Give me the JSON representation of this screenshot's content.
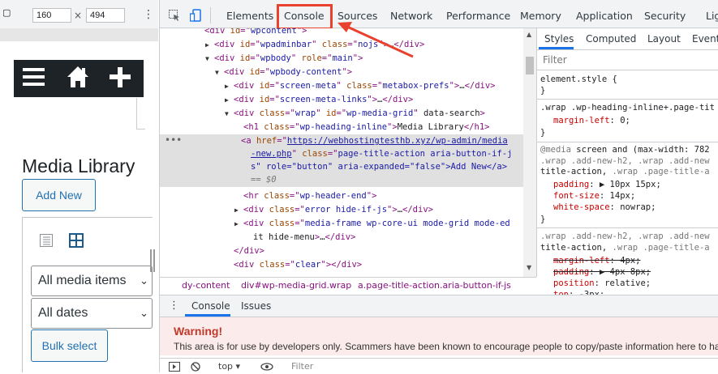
{
  "device_toolbar": {
    "selector_glyph": "▢",
    "width_value": "160",
    "height_value": "494",
    "times": "×",
    "more": "⋮"
  },
  "wordpress": {
    "page_title": "Media Library",
    "add_new": "Add New",
    "media_filter": "All media items",
    "date_filter": "All dates",
    "bulk_select": "Bulk select"
  },
  "devtools": {
    "tabs": [
      "Elements",
      "Console",
      "Sources",
      "Network",
      "Performance",
      "Memory",
      "Application",
      "Security",
      "Lig"
    ],
    "highlighted_tab": "Console",
    "elements_lines": [
      {
        "indent": 3,
        "tri": "",
        "html": "<div id=\"wpcontent\">"
      },
      {
        "indent": 4,
        "tri": "▶",
        "html": "<div id=\"wpadminbar\" class=\"nojs\">…</div>"
      },
      {
        "indent": 4,
        "tri": "▼",
        "html": "<div id=\"wpbody\" role=\"main\">"
      },
      {
        "indent": 5,
        "tri": "▼",
        "html": "<div id=\"wpbody-content\">"
      },
      {
        "indent": 6,
        "tri": "▶",
        "html": "<div id=\"screen-meta\" class=\"metabox-prefs\">…</div>"
      },
      {
        "indent": 6,
        "tri": "▶",
        "html": "<div id=\"screen-meta-links\">…</div>"
      },
      {
        "indent": 6,
        "tri": "▼",
        "html": "<div class=\"wrap\" id=\"wp-media-grid\" data-search>"
      },
      {
        "indent": 7,
        "tri": "",
        "html": "<h1 class=\"wp-heading-inline\">Media Library</h1>"
      }
    ],
    "selected_link": {
      "href_line1": "https://webhostingtesthb.xyz/wp-admin/media",
      "href_line2": "-new.php",
      "class_text": "page-title-action aria-button-if-j",
      "line3_pre": "s\" role=\"button\" aria-expanded=\"false\">Add New</a>",
      "eq": "== $0"
    },
    "elements_after": [
      {
        "indent": 7,
        "tri": "",
        "html": "<hr class=\"wp-header-end\">"
      },
      {
        "indent": 7,
        "tri": "▶",
        "html": "<div class=\"error hide-if-js\">…</div>"
      },
      {
        "indent": 7,
        "tri": "▶",
        "html": "<div class=\"media-frame wp-core-ui mode-grid mode-ed"
      },
      {
        "indent": 8,
        "tri": "",
        "html": "it hide-menu\">…</div>"
      },
      {
        "indent": 6,
        "tri": "",
        "html": "</div>"
      },
      {
        "indent": 6,
        "tri": "",
        "html": "<div class=\"clear\"></div>"
      }
    ],
    "breadcrumbs": [
      "dy-content",
      "div#wp-media-grid.wrap",
      "a.page-title-action.aria-button-if-js"
    ],
    "styles_tabs": [
      "Styles",
      "Computed",
      "Layout",
      "Event"
    ],
    "styles_filter": "Filter",
    "drawer_tabs": [
      "Console",
      "Issues"
    ],
    "warning_title": "Warning!",
    "warning_text": "This area is for use by developers only. Scammers have been known to encourage people to copy/paste information here to hac",
    "console_context": "top ▾",
    "console_filter": "Filter"
  },
  "colors": {
    "highlight_red": "#e8412d",
    "wp_blue": "#2271b1",
    "wp_dark": "#1d2327"
  }
}
